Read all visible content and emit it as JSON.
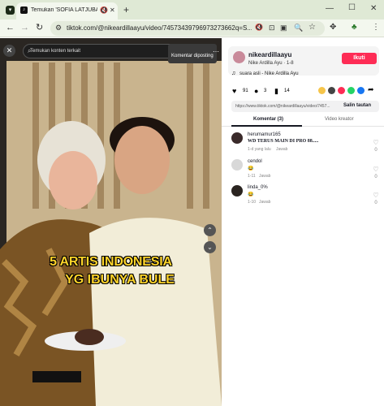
{
  "browser": {
    "tab_title": "Temukan 'SOFIA LATJUBA'",
    "url": "tiktok.com/@nikeardillaayu/video/74573439796973273662q=S..."
  },
  "overlay": {
    "search_placeholder": "Temukan konten terkait",
    "tooltip": "Komentar diposting",
    "caption_line1": "5 ARTIS INDONESIA",
    "caption_line2": "YG IBUNYA BULE"
  },
  "panel": {
    "username": "nikeardillaayu",
    "display_name": "Nike Ardilla Ayu · 1-8",
    "follow_label": "Ikuti",
    "sound": "suara asli - Nike Ardilla Ayu",
    "likes": "91",
    "comments_count": "3",
    "saves": "14",
    "link": "https://www.tiktok.com/@nikeardillaayu/video/7457...",
    "copy_label": "Salin tautan",
    "tab_comments": "Komentar (3)",
    "tab_creator": "Video kreator"
  },
  "comments": [
    {
      "user": "herumamur165",
      "text": "WD TERUS MAIN DI PRO 88.....",
      "meta": "1-d yang lalu",
      "reply": "Jawab",
      "likes": "0"
    },
    {
      "user": "cendol",
      "text": "😂",
      "meta": "1-11",
      "reply": "Jawab",
      "likes": "0"
    },
    {
      "user": "linda_0%",
      "text": "😂",
      "meta": "1-10",
      "reply": "Jawab",
      "likes": "0"
    }
  ],
  "colors": {
    "follow": "#fe2c55",
    "tabbar": "#dfe9d5",
    "toolbar": "#f3f7ee"
  }
}
